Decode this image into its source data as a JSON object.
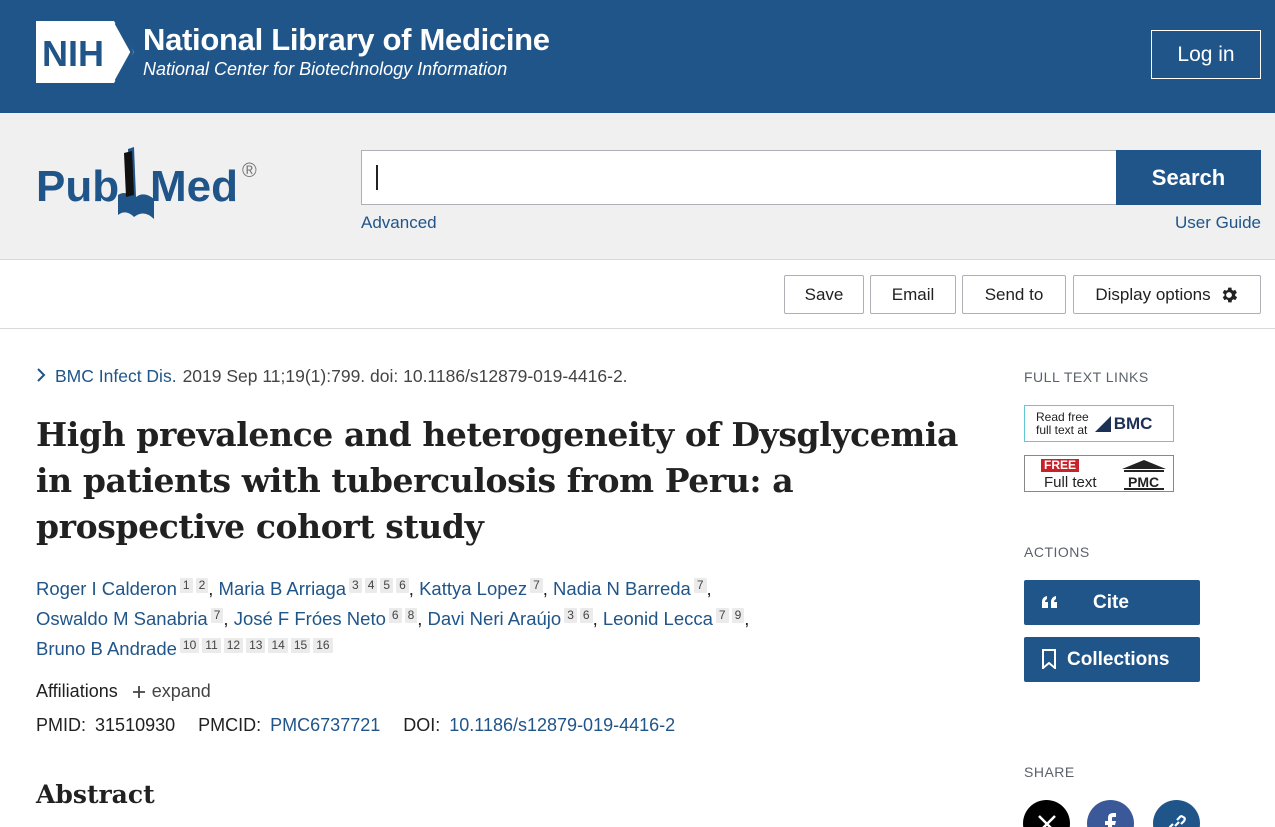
{
  "nih": {
    "logo_text": "NIH",
    "title": "National Library of Medicine",
    "subtitle": "National Center for Biotechnology Information",
    "login_label": "Log in"
  },
  "search": {
    "logo_text_left": "Pub",
    "logo_text_right": "Med",
    "logo_reg": "®",
    "value": "",
    "button_label": "Search",
    "advanced_label": "Advanced",
    "user_guide_label": "User Guide"
  },
  "toolbar": {
    "save_label": "Save",
    "email_label": "Email",
    "send_to_label": "Send to",
    "display_options_label": "Display options"
  },
  "citation": {
    "journal": "BMC Infect Dis.",
    "details": "2019 Sep 11;19(1):799. doi: 10.1186/s12879-019-4416-2.",
    "title": "High prevalence and heterogeneity of Dysglycemia in patients with tuberculosis from Peru: a prospective cohort study",
    "authors": [
      {
        "name": "Roger I Calderon",
        "affils": [
          "1",
          "2"
        ],
        "sep": ","
      },
      {
        "name": "Maria B Arriaga",
        "affils": [
          "3",
          "4",
          "5",
          "6"
        ],
        "sep": ","
      },
      {
        "name": "Kattya Lopez",
        "affils": [
          "7"
        ],
        "sep": ","
      },
      {
        "name": "Nadia N Barreda",
        "affils": [
          "7"
        ],
        "sep": ","
      },
      {
        "name": "Oswaldo M Sanabria",
        "affils": [
          "7"
        ],
        "sep": ","
      },
      {
        "name": "José F Fróes Neto",
        "affils": [
          "6",
          "8"
        ],
        "sep": ","
      },
      {
        "name": "Davi Neri Araújo",
        "affils": [
          "3",
          "6"
        ],
        "sep": ","
      },
      {
        "name": "Leonid Lecca",
        "affils": [
          "7",
          "9"
        ],
        "sep": ","
      },
      {
        "name": "Bruno B Andrade",
        "affils": [
          "10",
          "11",
          "12",
          "13",
          "14",
          "15",
          "16"
        ],
        "sep": ""
      }
    ],
    "affiliations_label": "Affiliations",
    "expand_label": "expand",
    "pmid_label": "PMID:",
    "pmid": "31510930",
    "pmcid_label": "PMCID:",
    "pmcid": "PMC6737721",
    "doi_label": "DOI:",
    "doi": "10.1186/s12879-019-4416-2",
    "abstract_heading": "Abstract"
  },
  "sidebar": {
    "full_text_heading": "FULL TEXT LINKS",
    "bmc_read_free": "Read free",
    "bmc_full_text_at": "full text at",
    "bmc_brand": "BMC",
    "pmc_free": "FREE",
    "pmc_full_text": "Full text",
    "pmc_brand": "PMC",
    "actions_heading": "ACTIONS",
    "cite_label": "Cite",
    "collections_label": "Collections",
    "share_heading": "SHARE"
  },
  "colors": {
    "nih_blue": "#20558a",
    "link_blue": "#20558a",
    "bmc_border": "#63c7d4",
    "free_red": "#c7222a"
  }
}
